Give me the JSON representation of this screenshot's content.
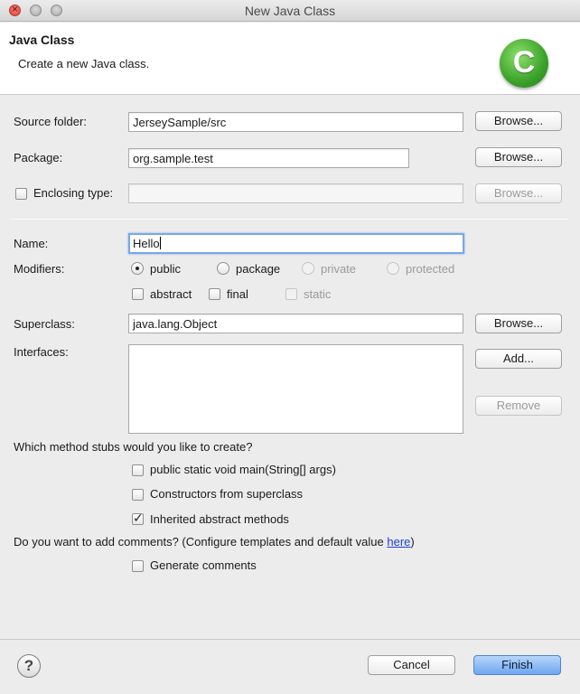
{
  "window": {
    "title": "New Java Class"
  },
  "banner": {
    "heading": "Java Class",
    "description": "Create a new Java class.",
    "icon": "java-class-wizard-icon"
  },
  "source_folder": {
    "label": "Source folder:",
    "value": "JerseySample/src",
    "browse_label": "Browse..."
  },
  "package": {
    "label": "Package:",
    "value": "org.sample.test",
    "browse_label": "Browse..."
  },
  "enclosing_type": {
    "label": "Enclosing type:",
    "value": "",
    "checked": false,
    "browse_label": "Browse..."
  },
  "name": {
    "label": "Name:",
    "value": "Hello"
  },
  "modifiers": {
    "label": "Modifiers:",
    "access": [
      {
        "label": "public",
        "selected": true,
        "enabled": true
      },
      {
        "label": "package",
        "selected": false,
        "enabled": true
      },
      {
        "label": "private",
        "selected": false,
        "enabled": false
      },
      {
        "label": "protected",
        "selected": false,
        "enabled": false
      }
    ],
    "flags": [
      {
        "label": "abstract",
        "checked": false,
        "enabled": true
      },
      {
        "label": "final",
        "checked": false,
        "enabled": true
      },
      {
        "label": "static",
        "checked": false,
        "enabled": false
      }
    ]
  },
  "superclass": {
    "label": "Superclass:",
    "value": "java.lang.Object",
    "browse_label": "Browse..."
  },
  "interfaces": {
    "label": "Interfaces:",
    "items": [],
    "add_label": "Add...",
    "remove_label": "Remove"
  },
  "stubs": {
    "question": "Which method stubs would you like to create?",
    "options": [
      {
        "label": "public static void main(String[] args)",
        "checked": false
      },
      {
        "label": "Constructors from superclass",
        "checked": false
      },
      {
        "label": "Inherited abstract methods",
        "checked": true
      }
    ]
  },
  "comments": {
    "question_prefix": "Do you want to add comments? (Configure templates and default value ",
    "link_text": "here",
    "question_suffix": ")",
    "option_label": "Generate comments",
    "checked": false
  },
  "footer": {
    "help_symbol": "?",
    "cancel_label": "Cancel",
    "finish_label": "Finish"
  }
}
